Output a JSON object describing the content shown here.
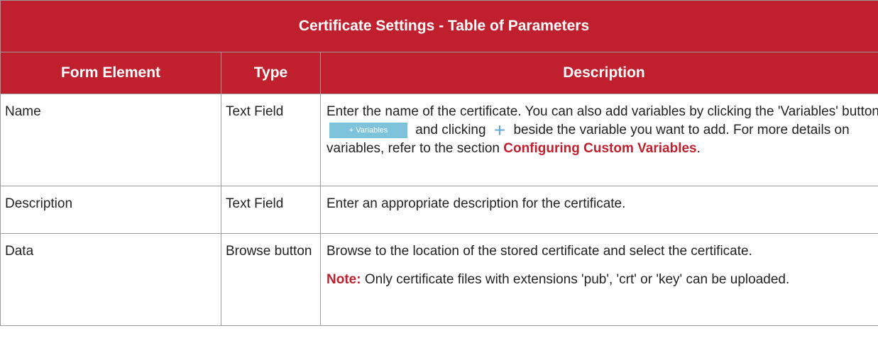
{
  "table": {
    "title": "Certificate Settings - Table of Parameters",
    "headers": {
      "form_element": "Form Element",
      "type": "Type",
      "description": "Description"
    },
    "rows": [
      {
        "element": "Name",
        "type": "Text Field",
        "desc_part1": "Enter the name of the certificate. You can also add variables by clicking the 'Variables' button",
        "variables_button_label": "+ Variables",
        "desc_part2": "and clicking",
        "plus_icon": "+",
        "desc_part3": "beside the variable you want to add. For more details on variables, refer to the section",
        "link_text": "Configuring Custom Variables",
        "desc_end": "."
      },
      {
        "element": "Description",
        "type": "Text Field",
        "desc": "Enter an appropriate description for the certificate."
      },
      {
        "element": "Data",
        "type": "Browse button",
        "desc": "Browse to the location of the stored certificate and select the certificate.",
        "note_label": "Note:",
        "note_text": "Only certificate files with extensions 'pub', 'crt' or 'key' can be uploaded."
      }
    ]
  },
  "colors": {
    "header_bg": "#c0202e",
    "header_text": "#ffffff",
    "link": "#c0202e",
    "variables_button_bg": "#7ec3dc",
    "plus_icon": "#5aa9d6"
  }
}
